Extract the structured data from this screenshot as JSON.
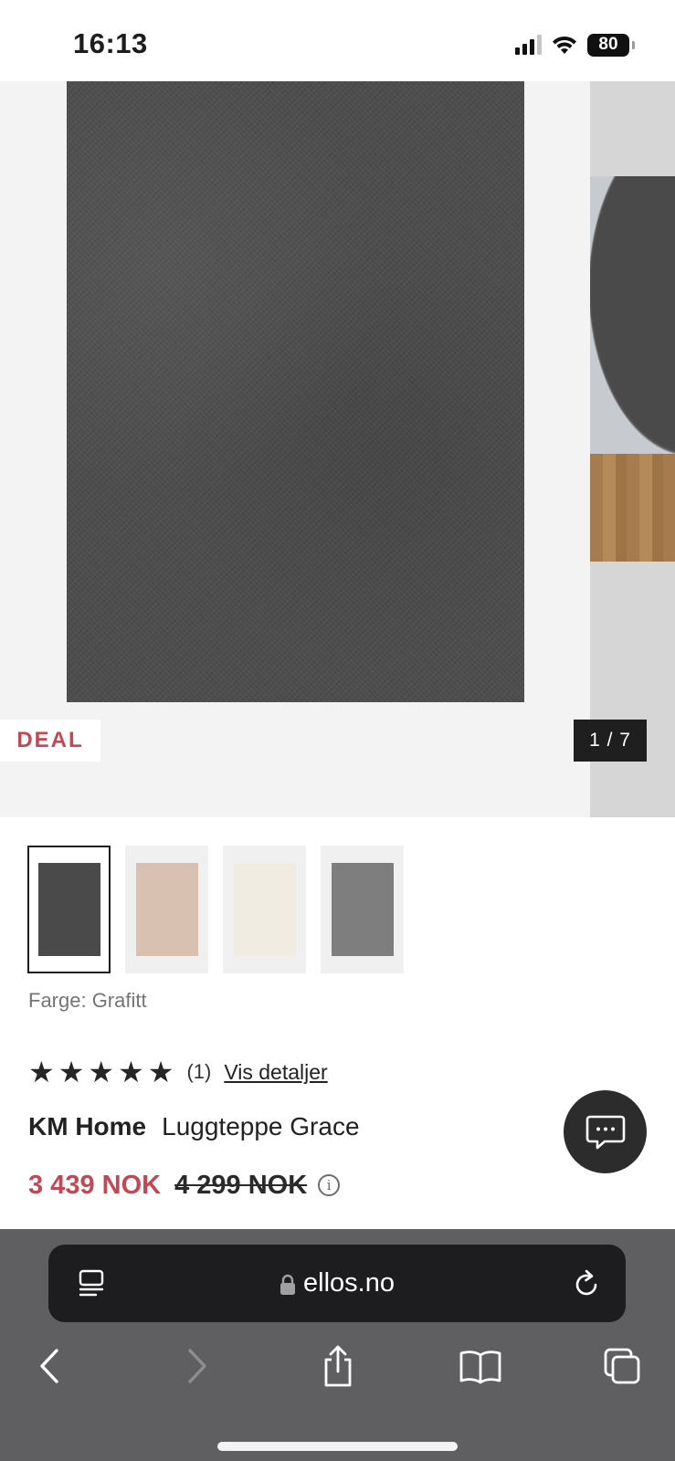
{
  "status_bar": {
    "time": "16:13",
    "battery": "80",
    "icons": [
      "cellular-signal-icon",
      "wifi-icon",
      "battery-icon"
    ]
  },
  "gallery": {
    "badge": "DEAL",
    "counter": "1 / 7",
    "badge_color": "#c24856"
  },
  "thumbnails": [
    {
      "name": "Grafitt",
      "color": "#4a4a4a",
      "selected": true
    },
    {
      "name": "beige",
      "color": "#d9c1b2",
      "selected": false
    },
    {
      "name": "cream",
      "color": "#f1ece2",
      "selected": false
    },
    {
      "name": "grey",
      "color": "#7e7e7e",
      "selected": false
    }
  ],
  "product": {
    "color_label": "Farge: Grafitt",
    "rating_stars": 5,
    "review_count": "(1)",
    "details_link": "Vis detaljer",
    "brand": "KM Home",
    "title": "Luggteppe Grace",
    "price_now": "3 439 NOK",
    "price_old": "4 299 NOK",
    "info_symbol": "i"
  },
  "browser": {
    "url": "ellos.no",
    "icons": [
      "reader-icon",
      "lock-icon",
      "reload-icon",
      "back-icon",
      "forward-icon",
      "share-icon",
      "bookmarks-icon",
      "tabs-icon"
    ]
  }
}
